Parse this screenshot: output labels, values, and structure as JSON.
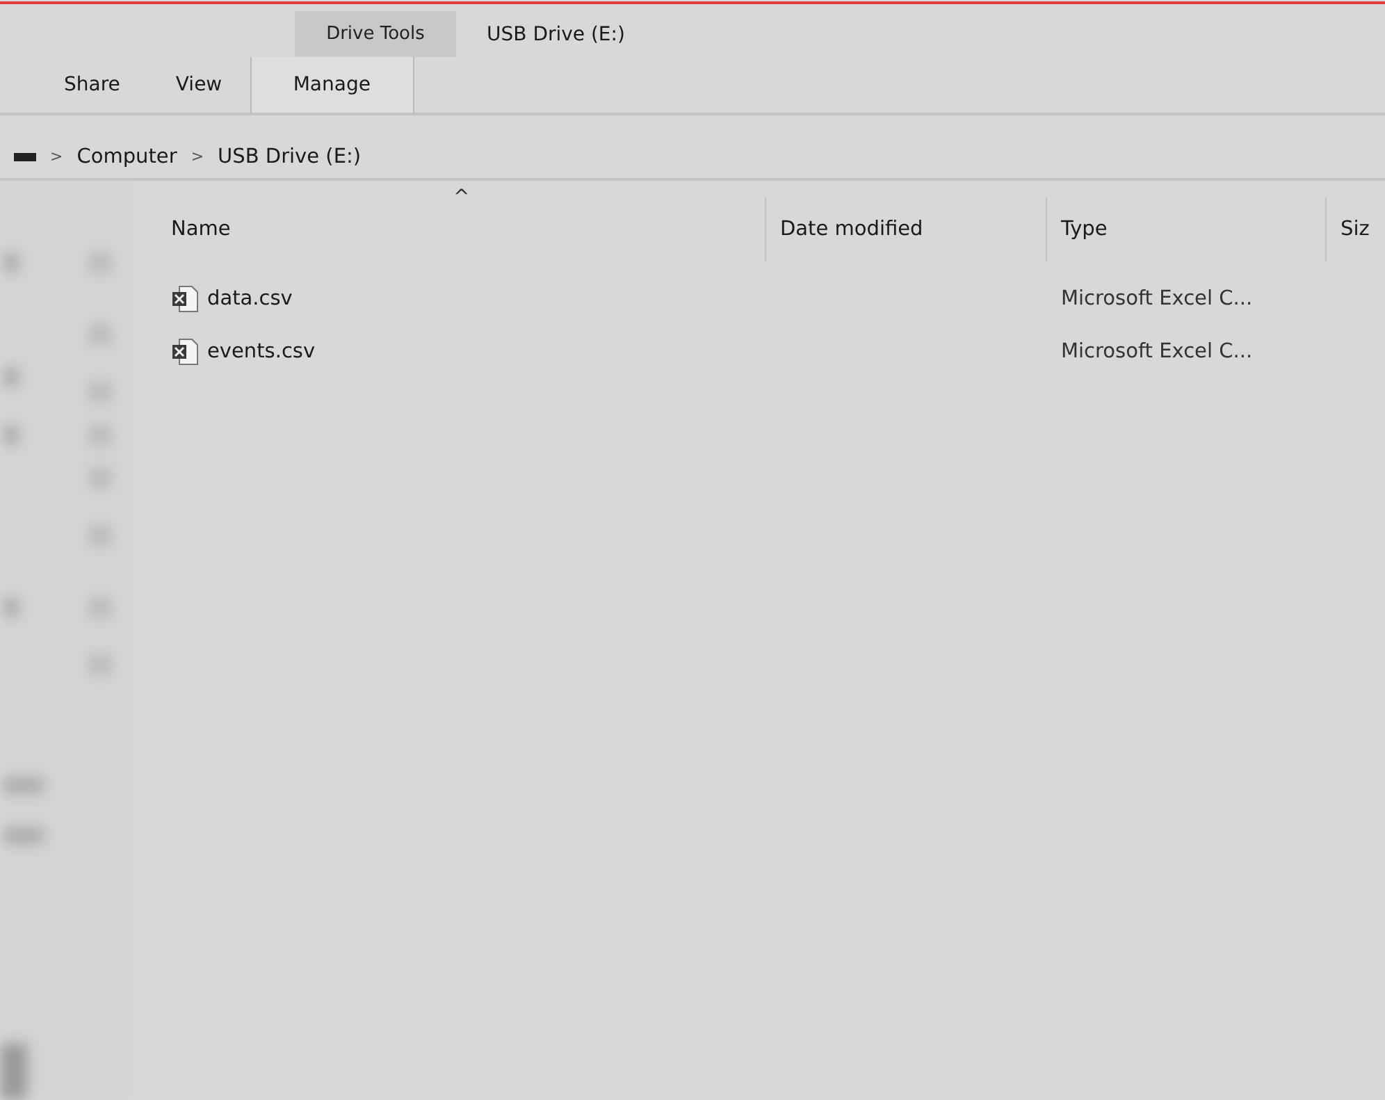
{
  "ribbon": {
    "context_header": "Drive Tools",
    "window_title": "USB Drive (E:)",
    "tabs": [
      {
        "label": "Share",
        "selected": false
      },
      {
        "label": "View",
        "selected": false
      },
      {
        "label": "Manage",
        "selected": true
      }
    ]
  },
  "address_bar": {
    "separator": ">",
    "crumbs": [
      "Computer",
      "USB Drive (E:)"
    ]
  },
  "file_list": {
    "sort_indicator": "^",
    "columns": [
      "Name",
      "Date modified",
      "Type",
      "Siz"
    ],
    "rows": [
      {
        "name": "data.csv",
        "date_modified": "",
        "type": "Microsoft Excel C..."
      },
      {
        "name": "events.csv",
        "date_modified": "",
        "type": "Microsoft Excel C..."
      }
    ]
  }
}
